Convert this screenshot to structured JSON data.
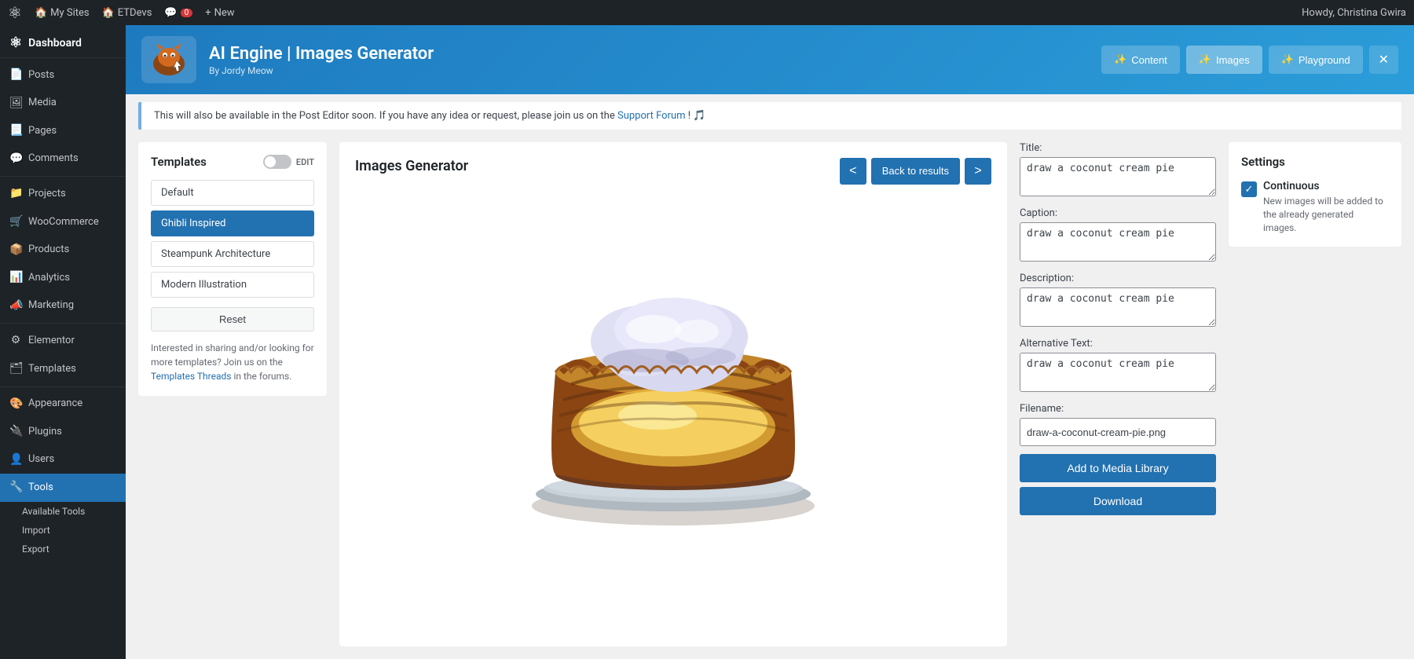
{
  "adminbar": {
    "wp_logo": "⚡",
    "sites_label": "My Sites",
    "site_name": "ETDevs",
    "comments_label": "0",
    "new_label": "New",
    "user_greeting": "Howdy, Christina Gwira"
  },
  "sidebar": {
    "dashboard_label": "Dashboard",
    "items": [
      {
        "id": "posts",
        "label": "Posts",
        "icon": "📄"
      },
      {
        "id": "media",
        "label": "Media",
        "icon": "🖼"
      },
      {
        "id": "pages",
        "label": "Pages",
        "icon": "📃"
      },
      {
        "id": "comments",
        "label": "Comments",
        "icon": "💬"
      },
      {
        "id": "projects",
        "label": "Projects",
        "icon": "📁"
      },
      {
        "id": "woocommerce",
        "label": "WooCommerce",
        "icon": "🛒"
      },
      {
        "id": "products",
        "label": "Products",
        "icon": "📦"
      },
      {
        "id": "analytics",
        "label": "Analytics",
        "icon": "📊"
      },
      {
        "id": "marketing",
        "label": "Marketing",
        "icon": "📣"
      },
      {
        "id": "elementor",
        "label": "Elementor",
        "icon": "⚙"
      },
      {
        "id": "templates",
        "label": "Templates",
        "icon": "🗂"
      },
      {
        "id": "appearance",
        "label": "Appearance",
        "icon": "🎨"
      },
      {
        "id": "plugins",
        "label": "Plugins",
        "icon": "🔌"
      },
      {
        "id": "users",
        "label": "Users",
        "icon": "👤"
      },
      {
        "id": "tools",
        "label": "Tools",
        "icon": "🔧",
        "active": true
      },
      {
        "id": "available-tools",
        "label": "Available Tools",
        "sub": true
      },
      {
        "id": "import",
        "label": "Import",
        "sub": true
      },
      {
        "id": "export",
        "label": "Export",
        "sub": true
      }
    ]
  },
  "plugin_header": {
    "logo_emoji": "🐱",
    "title": "AI Engine | Images Generator",
    "author": "By Jordy Meow",
    "nav_buttons": [
      {
        "id": "content",
        "label": "Content",
        "icon": "✨"
      },
      {
        "id": "images",
        "label": "Images",
        "icon": "✨",
        "active": true
      },
      {
        "id": "playground",
        "label": "Playground",
        "icon": "✨"
      }
    ],
    "close_icon": "✕"
  },
  "notice": {
    "text_before": "This will also be available in the Post Editor soon. If you have any idea or request, please join us on the",
    "link_text": "Support Forum",
    "text_after": "! 🎵"
  },
  "templates_panel": {
    "title": "Templates",
    "toggle_label": "EDIT",
    "items": [
      {
        "id": "default",
        "label": "Default",
        "active": false
      },
      {
        "id": "ghibli",
        "label": "Ghibli Inspired",
        "active": true
      },
      {
        "id": "steampunk",
        "label": "Steampunk Architecture",
        "active": false
      },
      {
        "id": "modern",
        "label": "Modern Illustration",
        "active": false
      }
    ],
    "reset_label": "Reset",
    "footer_text": "Interested in sharing and/or looking for more templates? Join us on the",
    "footer_link_text": "Templates Threads",
    "footer_text_after": " in the forums."
  },
  "generator_panel": {
    "title": "Images Generator",
    "nav_prev": "<",
    "nav_next": ">",
    "back_label": "Back to results"
  },
  "metadata": {
    "title_label": "Title:",
    "title_value": "draw a coconut cream pie",
    "caption_label": "Caption:",
    "caption_value": "draw a coconut cream pie",
    "description_label": "Description:",
    "description_value": "draw a coconut cream pie",
    "alt_label": "Alternative Text:",
    "alt_value": "draw a coconut cream pie",
    "filename_label": "Filename:",
    "filename_value": "draw-a-coconut-cream-pie.png",
    "add_to_media_label": "Add to Media Library",
    "download_label": "Download"
  },
  "settings_panel": {
    "title": "Settings",
    "continuous_label": "Continuous",
    "continuous_desc": "New images will be added to the already generated images.",
    "continuous_checked": true
  }
}
